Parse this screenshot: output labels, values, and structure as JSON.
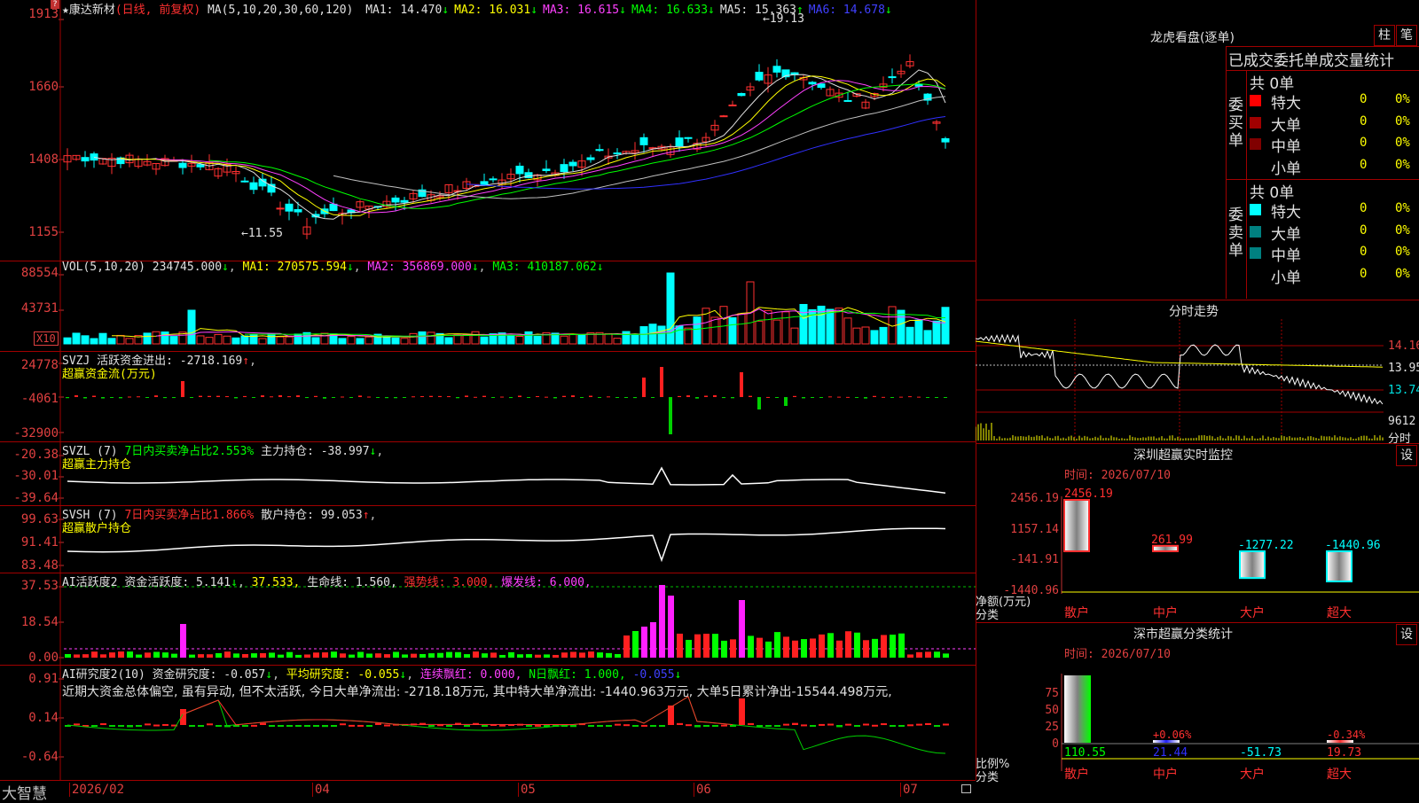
{
  "main": {
    "stock": "康达新材",
    "mode": "(日线, 前复权)",
    "ma_label": "MA(5,10,20,30,60,120)",
    "ma": [
      {
        "label": "MA1:",
        "value": "14.470",
        "color": "#e0e0e0"
      },
      {
        "label": "MA2:",
        "value": "16.031",
        "color": "#ffff00"
      },
      {
        "label": "MA3:",
        "value": "16.615",
        "color": "#ff40ff"
      },
      {
        "label": "MA4:",
        "value": "16.633",
        "color": "#00ff00"
      },
      {
        "label": "MA5:",
        "value": "15.363",
        "color": "#e0e0e0"
      },
      {
        "label": "MA6:",
        "value": "14.678",
        "color": "#4040ff"
      }
    ],
    "y_ticks": [
      "1913",
      "1660",
      "1408",
      "1155"
    ],
    "high_label": "19.13",
    "low_label": "11.55"
  },
  "vol": {
    "title": "VOL(5,10,20)",
    "value": "234745.000",
    "ma": [
      {
        "label": "MA1:",
        "value": "270575.594"
      },
      {
        "label": "MA2:",
        "value": "356869.000"
      },
      {
        "label": "MA3:",
        "value": "410187.062"
      }
    ],
    "y_ticks": [
      "88554",
      "43731"
    ],
    "unit": "X10"
  },
  "svzj": {
    "title": "SVZJ",
    "label": "活跃资金进出:",
    "value": "-2718.169",
    "subtitle": "超赢资金流(万元)",
    "y_ticks": [
      "24778",
      "-4061",
      "-32900"
    ]
  },
  "svzl": {
    "title": "SVZL (7)",
    "ratio": "7日内买卖净占比2.553%",
    "label": "主力持仓:",
    "value": "-38.997",
    "subtitle": "超赢主力持仓",
    "y_ticks": [
      "-20.38",
      "-30.01",
      "-39.64"
    ]
  },
  "svsh": {
    "title": "SVSH (7)",
    "ratio": "7日内买卖净占比1.866%",
    "label": "散户持仓:",
    "value": "99.053",
    "subtitle": "超赢散户持仓",
    "y_ticks": [
      "99.63",
      "91.41",
      "83.48"
    ]
  },
  "ai1": {
    "title": "AI活跃度2",
    "label": "资金活跃度:",
    "value": "5.141",
    "v2": "37.533,",
    "life": "生命线: 1.560,",
    "strong": "强势线: 3.000,",
    "burst": "爆发线: 6.000,",
    "y_ticks": [
      "37.53",
      "18.54",
      "0.00"
    ]
  },
  "ai2": {
    "title": "AI研究度2(10)",
    "label": "资金研究度:",
    "value": "-0.057",
    "avg": "平均研究度: -0.055",
    "red": "连续飘红: 0.000,",
    "nred": "N日飘红: 1.000,",
    "v5": "-0.055",
    "summary": "近期大资金总体偏空, 虽有异动, 但不太活跃, 今日大单净流出: -2718.18万元, 其中特大单净流出: -1440.963万元, 大单5日累计净出-15544.498万元,",
    "y_ticks": [
      "0.91",
      "0.14",
      "-0.64"
    ]
  },
  "xaxis": {
    "brand": "大智慧",
    "labels": [
      "2026/02",
      "04",
      "05",
      "06",
      "07"
    ]
  },
  "right": {
    "dragon_title": "龙虎看盘(逐单)",
    "btn_zhu": "柱",
    "btn_bi": "笔",
    "stats_title": "已成交委托单成交量统计",
    "buy_side": "委买单",
    "sell_side": "委卖单",
    "buy_total": "共 0单",
    "sell_total": "共 0单",
    "buy_rows": [
      {
        "name": "特大",
        "count": "0",
        "pct": "0%",
        "color": "#ff0000"
      },
      {
        "name": "大单",
        "count": "0",
        "pct": "0%",
        "color": "#a00000"
      },
      {
        "name": "中单",
        "count": "0",
        "pct": "0%",
        "color": "#800000"
      },
      {
        "name": "小单",
        "count": "0",
        "pct": "0%",
        "color": ""
      }
    ],
    "sell_rows": [
      {
        "name": "特大",
        "count": "0",
        "pct": "0%",
        "color": "#00ffff"
      },
      {
        "name": "大单",
        "count": "0",
        "pct": "0%",
        "color": "#008080"
      },
      {
        "name": "中单",
        "count": "0",
        "pct": "0%",
        "color": "#008080"
      },
      {
        "name": "小单",
        "count": "0",
        "pct": "0%",
        "color": ""
      }
    ],
    "intraday_title": "分时走势",
    "intraday_ticks": [
      "14.16",
      "13.95",
      "13.74",
      "9612",
      "分时"
    ],
    "sz_title": "深圳超赢实时监控",
    "sz_time": "时间: 2026/07/10",
    "sz_ticks": [
      "2456.19",
      "1157.14",
      "-141.91",
      "-1440.96"
    ],
    "sz_unit": "净额(万元)",
    "sz_axis": "分类",
    "sz_bars": [
      {
        "cat": "散户",
        "value": "2456.19",
        "num": 2456.19,
        "cat_color": "#ff3030"
      },
      {
        "cat": "中户",
        "value": "261.99",
        "num": 261.99,
        "cat_color": "#ff3030"
      },
      {
        "cat": "大户",
        "value": "-1277.22",
        "num": -1277.22,
        "cat_color": "#ff3030"
      },
      {
        "cat": "超大",
        "value": "-1440.96",
        "num": -1440.96,
        "cat_color": "#ff3030"
      }
    ],
    "cls_title": "深市超赢分类统计",
    "cls_time": "时间: 2026/07/10",
    "cls_ticks": [
      "75",
      "50",
      "25",
      "0"
    ],
    "cls_unit": "比例%",
    "cls_axis": "分类",
    "cls_bars": [
      {
        "cat": "散户",
        "value": "110.55",
        "pct": "",
        "num": 110.55
      },
      {
        "cat": "中户",
        "value": "21.44",
        "pct": "+0.06%",
        "num": 21.44
      },
      {
        "cat": "大户",
        "value": "-51.73",
        "pct": "",
        "num": -51.73
      },
      {
        "cat": "超大",
        "value": "19.73",
        "pct": "-0.34%",
        "num": 19.73
      }
    ],
    "set_btn": "设"
  }
}
